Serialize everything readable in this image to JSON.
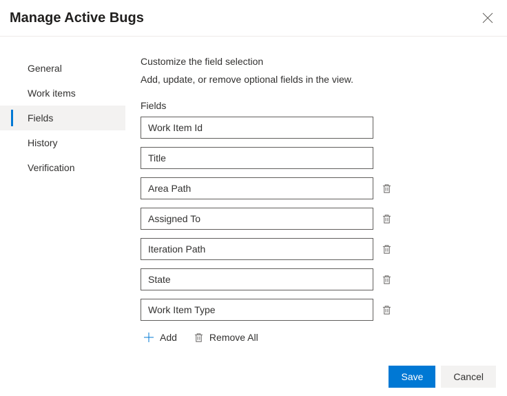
{
  "header": {
    "title": "Manage Active Bugs"
  },
  "sidebar": {
    "items": [
      {
        "label": "General",
        "selected": false
      },
      {
        "label": "Work items",
        "selected": false
      },
      {
        "label": "Fields",
        "selected": true
      },
      {
        "label": "History",
        "selected": false
      },
      {
        "label": "Verification",
        "selected": false
      }
    ]
  },
  "content": {
    "title": "Customize the field selection",
    "description": "Add, update, or remove optional fields in the view.",
    "fields_label": "Fields",
    "fields": [
      {
        "value": "Work Item Id",
        "deletable": false
      },
      {
        "value": "Title",
        "deletable": false
      },
      {
        "value": "Area Path",
        "deletable": true
      },
      {
        "value": "Assigned To",
        "deletable": true
      },
      {
        "value": "Iteration Path",
        "deletable": true
      },
      {
        "value": "State",
        "deletable": true
      },
      {
        "value": "Work Item Type",
        "deletable": true
      }
    ],
    "add_label": "Add",
    "remove_all_label": "Remove All"
  },
  "footer": {
    "save_label": "Save",
    "cancel_label": "Cancel"
  }
}
